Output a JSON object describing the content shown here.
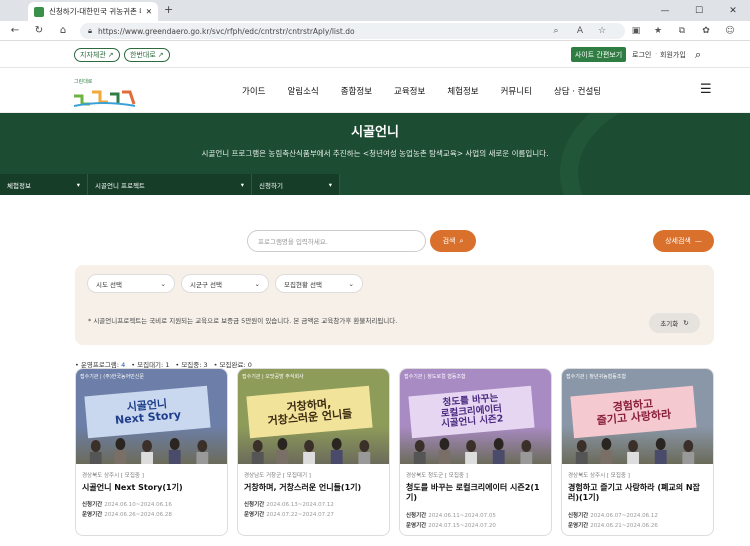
{
  "browser": {
    "tab_title": "신청하기-대한민국 귀농귀촌 대표",
    "url": "https://www.greendaero.go.kr/svc/rfph/edc/cntrstr/cntrstrAply/list.do"
  },
  "util": {
    "pill1": "지자체관",
    "pill2": "한번대로",
    "sitemap": "사이트 간편보기",
    "login": "로그인",
    "join": "회원가입"
  },
  "logo": {
    "small": "그린대로"
  },
  "gnb": [
    "가이드",
    "알림소식",
    "종합정보",
    "교육정보",
    "체험정보",
    "커뮤니티",
    "상담 · 컨설팅"
  ],
  "hero": {
    "title": "시골언니",
    "desc": "시골언니 프로그램은 농림축산식품부에서 추진하는 <청년여성 농업농촌 탐색교육> 사업의 새로운 이름입니다."
  },
  "crumbs": [
    "체험정보",
    "시골언니 프로젝트",
    "신청하기"
  ],
  "search": {
    "placeholder": "프로그램명을 입력하세요.",
    "button": "검색",
    "detail": "상세검색"
  },
  "filters": {
    "sido": "시도 선택",
    "sigungu": "시군구 선택",
    "status": "모집현황 선택",
    "notice": "* 시골언니프로젝트는 국비로 지원되는 교육으로 보증금 5만원이 있습니다. 본 금액은 교육참가후 환불처리됩니다.",
    "reset": "초기화"
  },
  "stats": {
    "running_label": "• 운영프로그램:",
    "running": "4",
    "waiting": "• 모집대기: 1",
    "recruiting": "• 모집중: 3",
    "closed": "• 모집완료: 0"
  },
  "cards": [
    {
      "top": "접수기관 | (주)한국농어민신문",
      "banner": "시골언니\nNext Story",
      "region": "경상북도 상주시 [ 모집중 ]",
      "title": "시골언니 Next Story(1기)",
      "apply_label": "신청기간",
      "apply": "2024.06.10~2024.06.16",
      "run_label": "운영기간",
      "run": "2024.06.26~2024.06.28",
      "bg": "#6d7fa8",
      "banner_bg": "#c9d7ef",
      "banner_color": "#1f3f8a"
    },
    {
      "top": "접수기관 | 오맛공방 주식회사",
      "banner": "거창하며,\n거창스러운 언니들",
      "region": "경상남도 거창군 [ 모집대기 ]",
      "title": "거창하며, 거창스러운 언니들(1기)",
      "apply_label": "신청기간",
      "apply": "2024.06.13~2024.07.12",
      "run_label": "운영기간",
      "run": "2024.07.22~2024.07.27",
      "bg": "#8e9c5a",
      "banner_bg": "#f2e39a",
      "banner_color": "#3a2a10"
    },
    {
      "top": "접수기관 | 청도로컬 협동조합",
      "banner": "청도를 바꾸는\n로컬크리에이터\n시골언니 시즌2",
      "region": "경상북도 청도군 [ 모집중 ]",
      "title": "청도를 바꾸는 로컬크리에이터 시즌2(1기)",
      "apply_label": "신청기간",
      "apply": "2024.06.11~2024.07.05",
      "run_label": "운영기간",
      "run": "2024.07.15~2024.07.20",
      "bg": "#a98bc4",
      "banner_bg": "#e6d6f2",
      "banner_color": "#4a2a80"
    },
    {
      "top": "접수기관 | 청년귀농협동조합",
      "banner": "경험하고\n즐기고 사랑하라",
      "region": "경상북도 상주시 [ 모집중 ]",
      "title": "경험하고 즐기고 사랑하라 (폐교의 N잡러)(1기)",
      "apply_label": "신청기간",
      "apply": "2024.06.07~2024.06.12",
      "run_label": "운영기간",
      "run": "2024.06.21~2024.06.26",
      "bg": "#8a97a8",
      "banner_bg": "#f4c9cf",
      "banner_color": "#8a1f3a"
    }
  ]
}
